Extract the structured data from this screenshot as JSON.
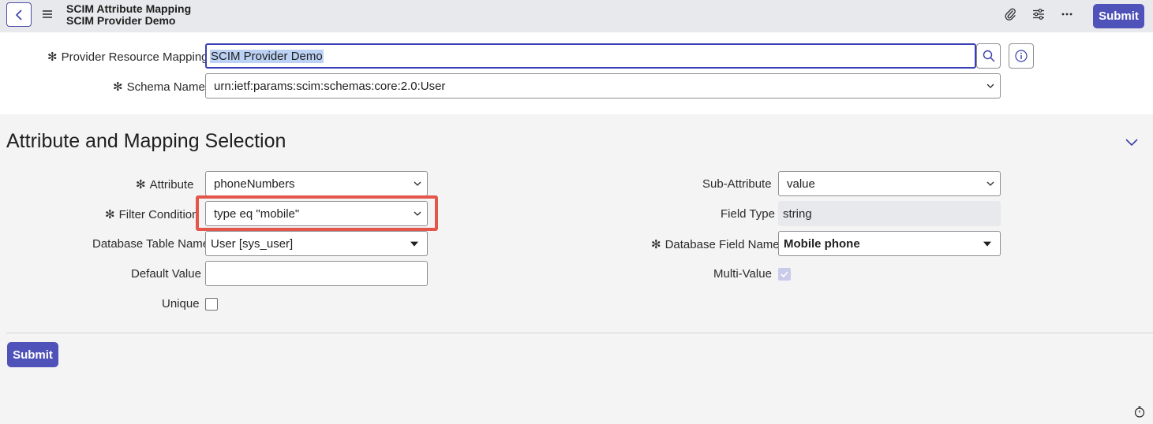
{
  "header": {
    "title_line1": "SCIM Attribute Mapping",
    "title_line2": "SCIM Provider Demo",
    "submit_label": "Submit",
    "icons": [
      "back-icon",
      "menu-icon",
      "paperclip-icon",
      "settings-sliders-icon",
      "more-icon"
    ]
  },
  "form_top": {
    "provider_label": "Provider Resource Mapping",
    "provider_value": "SCIM Provider Demo",
    "schema_label": "Schema Name",
    "schema_value": "urn:ietf:params:scim:schemas:core:2.0:User"
  },
  "section": {
    "title": "Attribute and Mapping Selection",
    "attribute_label": "Attribute",
    "attribute_value": "phoneNumbers",
    "filter_label": "Filter Condition",
    "filter_value": "type eq \"mobile\"",
    "db_table_label": "Database Table Name",
    "db_table_value": "User [sys_user]",
    "default_label": "Default Value",
    "default_value": "",
    "unique_label": "Unique",
    "unique_checked": false,
    "subattr_label": "Sub-Attribute",
    "subattr_value": "value",
    "field_type_label": "Field Type",
    "field_type_value": "string",
    "db_field_label": "Database Field Name",
    "db_field_value": "Mobile phone",
    "multi_label": "Multi-Value",
    "multi_checked": true
  },
  "footer": {
    "submit_label": "Submit"
  },
  "colors": {
    "accent": "#4f52b8",
    "highlight": "#e3564a",
    "header_bg": "#e8e9ec"
  }
}
